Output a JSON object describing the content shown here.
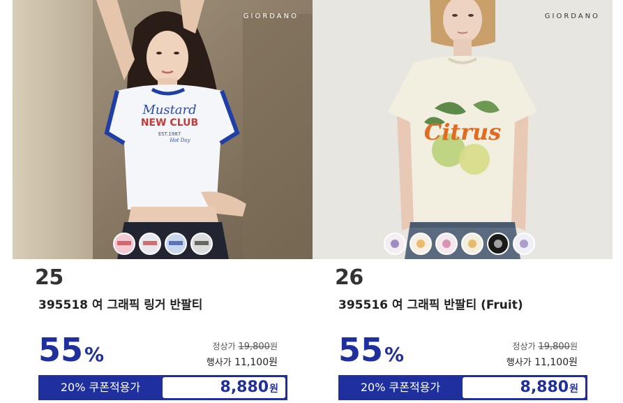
{
  "products": [
    {
      "brand_logo": "GIORDANO",
      "rank": "25",
      "name": "395518 여 그래픽 링거 반팔티",
      "discount_number": "55",
      "discount_unit": "%",
      "regular_label": "정상가",
      "regular_price": "19,800",
      "regular_unit": "원",
      "sale_label": "행사가",
      "sale_price": "11,100",
      "sale_unit": "원",
      "coupon_label": "20% 쿠폰적용가",
      "coupon_price": "8,880",
      "coupon_unit": "원",
      "image_text": {
        "shirt_graphic_script": "Mustard",
        "shirt_graphic_main": "NEW CLUB",
        "shirt_graphic_sub": "EST.1987",
        "shirt_graphic_tail": "Hot Day"
      },
      "swatches": [
        "#f3c9d6",
        "#e8e8ee",
        "#c9d7ee",
        "#dcdcdc"
      ]
    },
    {
      "brand_logo": "GIORDANO",
      "rank": "26",
      "name": "395516 여 그래픽 반팔티 (Fruit)",
      "discount_number": "55",
      "discount_unit": "%",
      "regular_label": "정상가",
      "regular_price": "19,800",
      "regular_unit": "원",
      "sale_label": "행사가",
      "sale_price": "11,100",
      "sale_unit": "원",
      "coupon_label": "20% 쿠폰적용가",
      "coupon_price": "8,880",
      "coupon_unit": "원",
      "image_text": {
        "shirt_graphic_script": "Citrus"
      },
      "swatches": [
        "#f3eef2",
        "#f6f1e4",
        "#f4e9ee",
        "#f3efe0",
        "#1a1a1a",
        "#eef0f5"
      ]
    }
  ],
  "colors": {
    "accent": "#1f2f9d",
    "rank_text": "#333333"
  }
}
